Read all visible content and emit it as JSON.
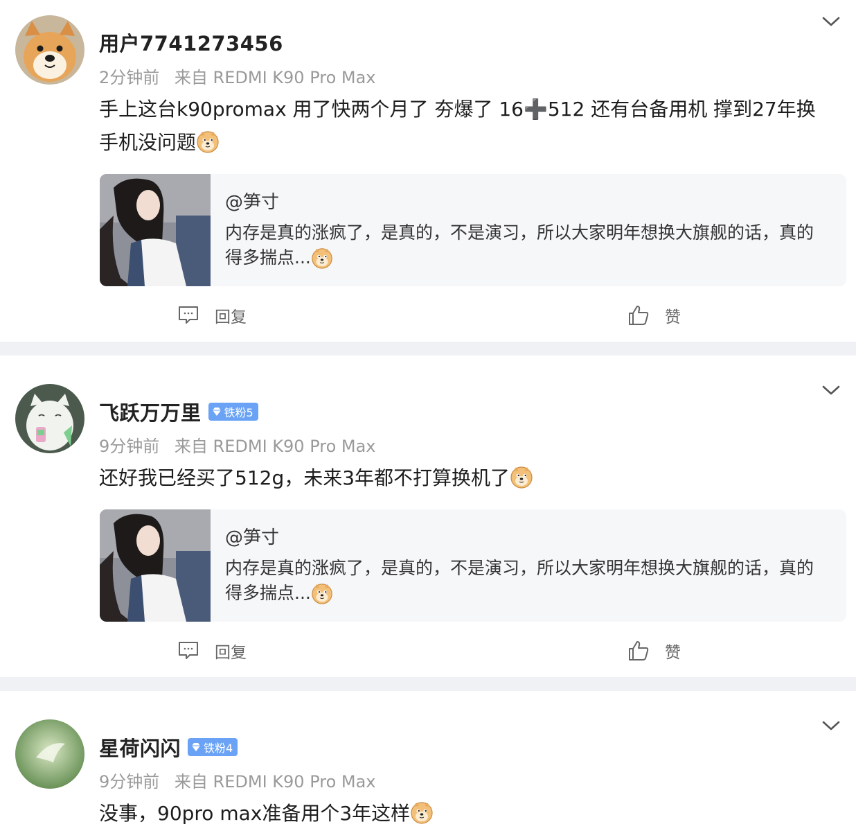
{
  "comments": [
    {
      "username": "用户7741273456",
      "time": "2分钟前",
      "source": "来自 REDMI K90 Pro Max",
      "text": "手上这台k90promax 用了快两个月了 夯爆了 16➕512 还有台备用机 撑到27年换手机没问题",
      "quote": {
        "author": "@笋寸",
        "text": "内存是真的涨疯了，是真的，不是演习，所以大家明年想换大旗舰的话，真的得多揣点..."
      },
      "reply_label": "回复",
      "like_label": "赞"
    },
    {
      "username": "飞跃万万里",
      "badge": "铁粉5",
      "time": "9分钟前",
      "source": "来自 REDMI K90 Pro Max",
      "text": "还好我已经买了512g，未来3年都不打算换机了",
      "quote": {
        "author": "@笋寸",
        "text": "内存是真的涨疯了，是真的，不是演习，所以大家明年想换大旗舰的话，真的得多揣点..."
      },
      "reply_label": "回复",
      "like_label": "赞"
    },
    {
      "username": "星荷闪闪",
      "badge": "铁粉4",
      "time": "9分钟前",
      "source": "来自 REDMI K90 Pro Max",
      "text": "没事，90pro max准备用个3年这样"
    }
  ],
  "colors": {
    "badge": "#6aa3f5",
    "divider": "#f0f1f5",
    "quote_bg": "#f6f7f9",
    "meta": "#9a9a9a"
  },
  "icons": [
    "chevron-down-icon",
    "comment-icon",
    "thumbs-up-icon",
    "doge-emoji-icon",
    "diamond-icon"
  ]
}
